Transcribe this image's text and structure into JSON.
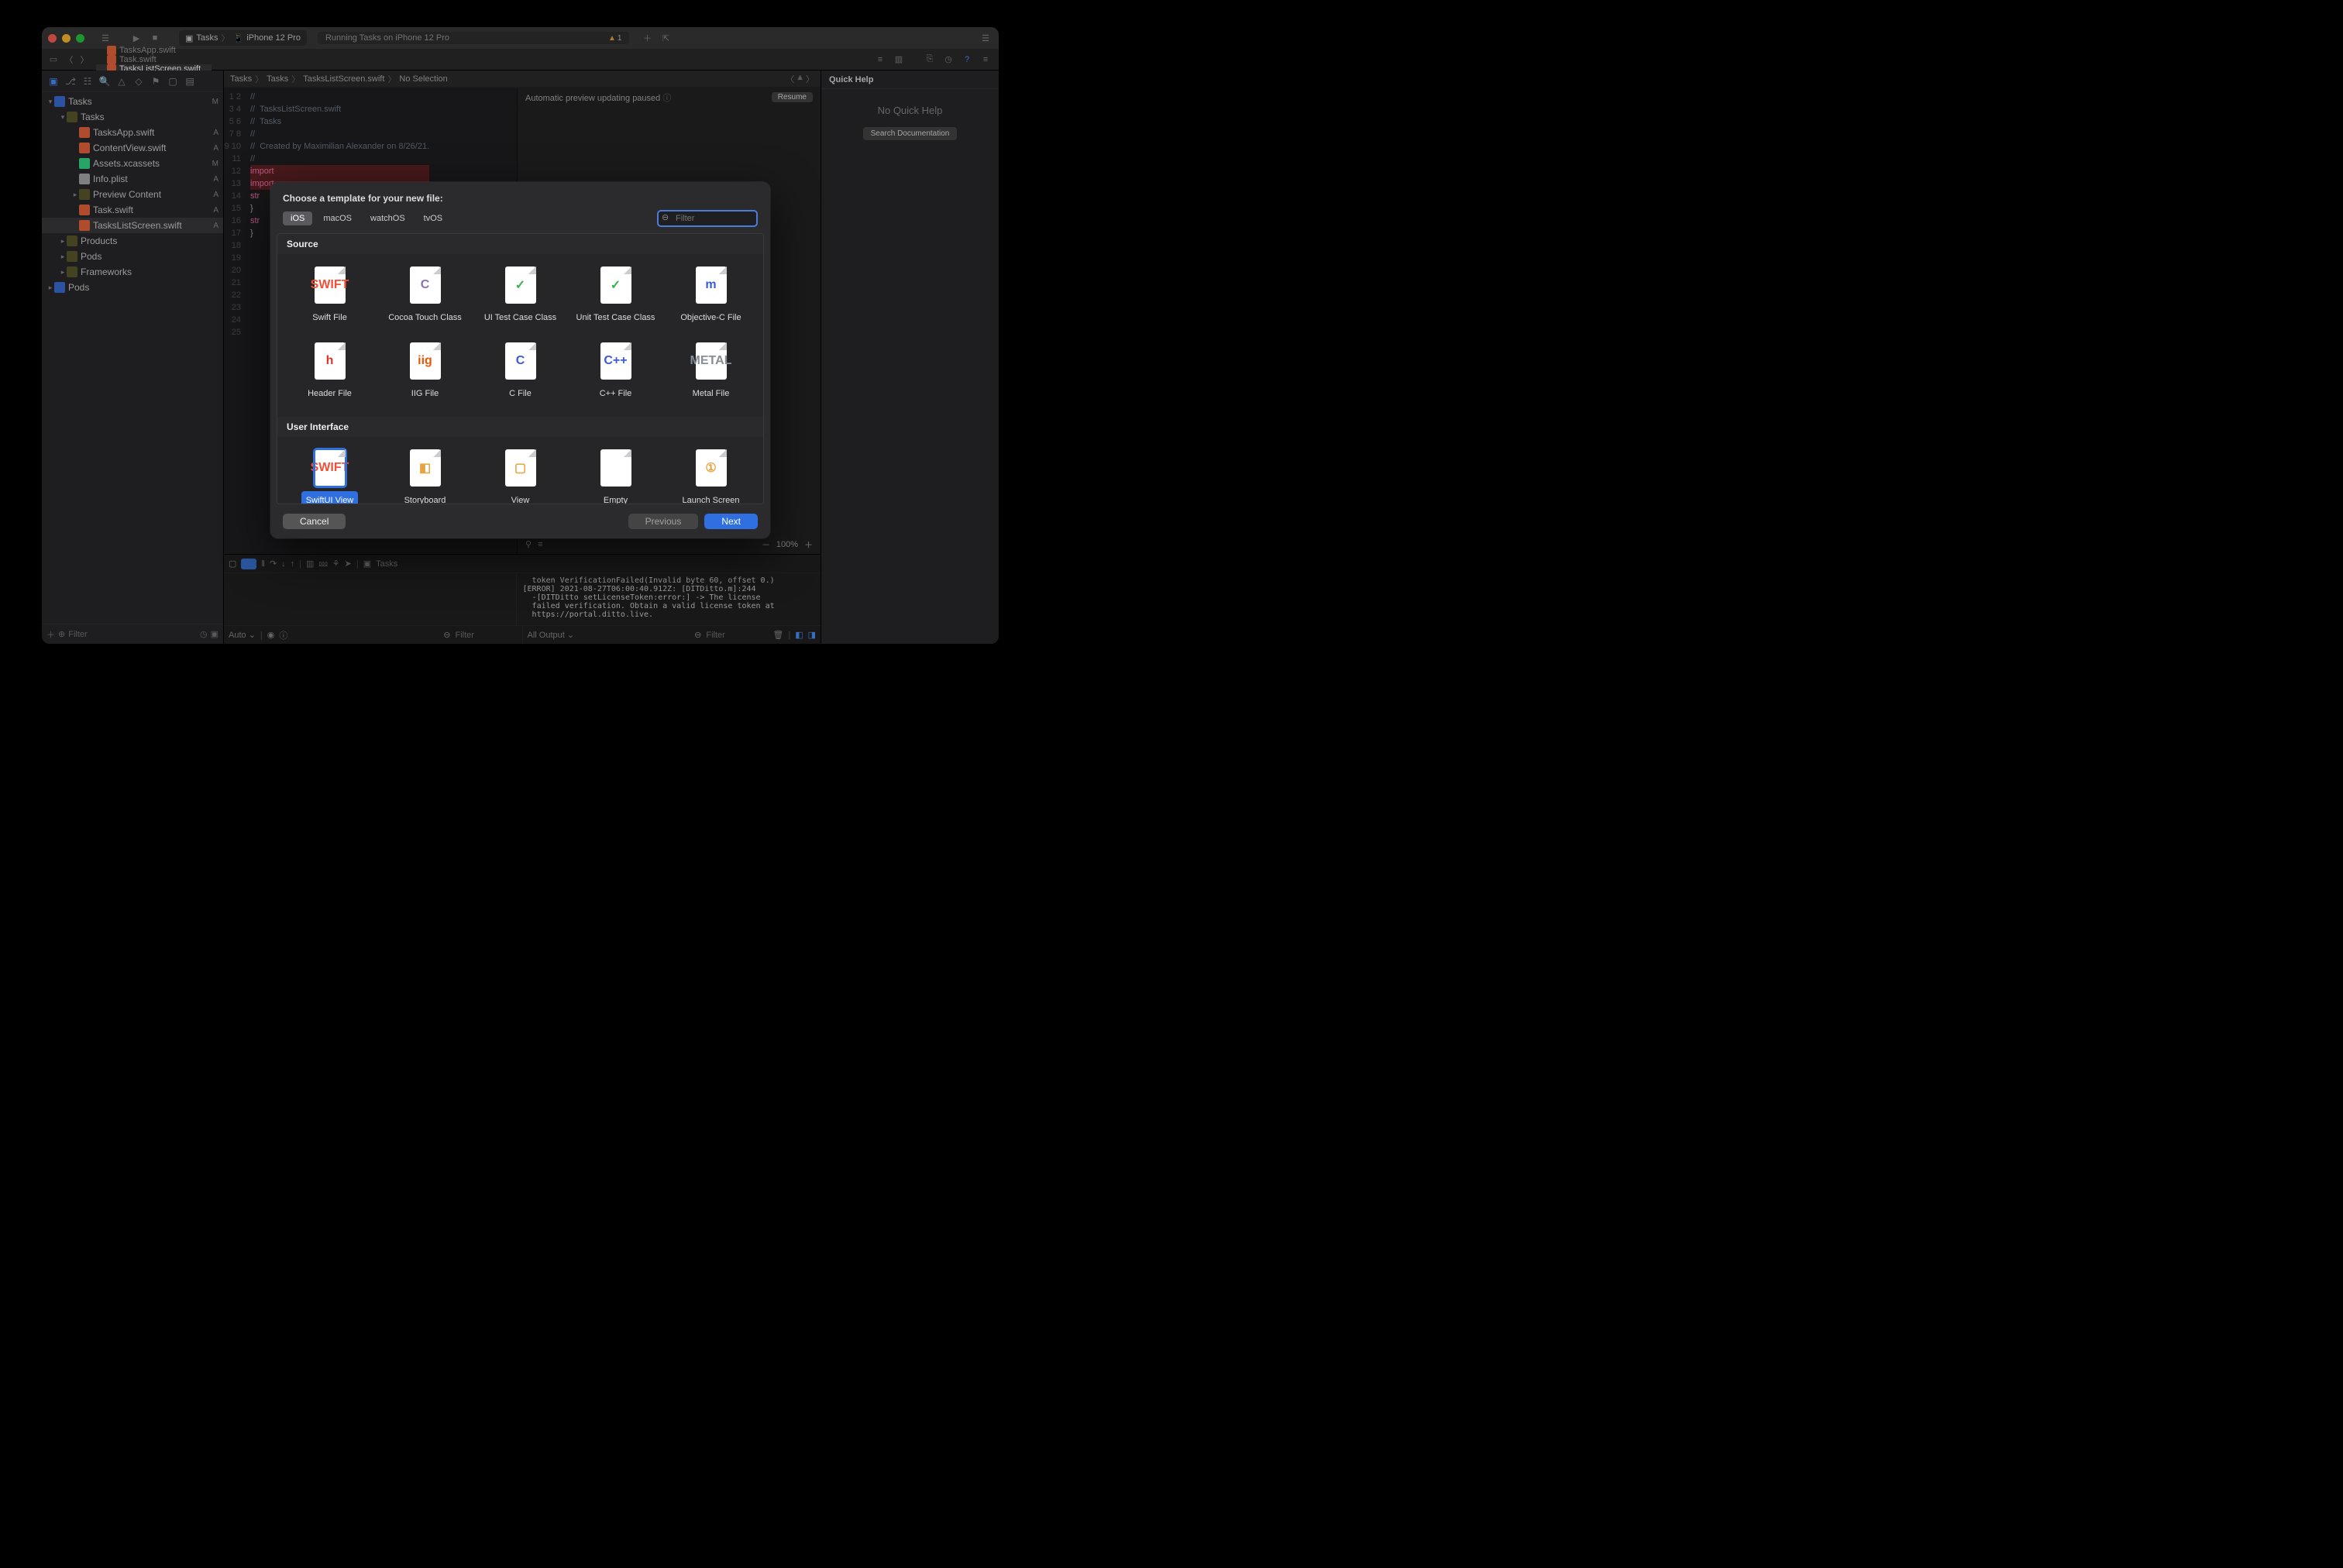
{
  "toolbar": {
    "scheme_app": "Tasks",
    "scheme_device": "iPhone 12 Pro",
    "status": "Running Tasks on iPhone 12 Pro",
    "warn_count": "1"
  },
  "tabs": [
    {
      "label": "TasksApp.swift",
      "active": false
    },
    {
      "label": "Task.swift",
      "active": false
    },
    {
      "label": "TasksListScreen.swift",
      "active": true
    }
  ],
  "jumpbar": [
    "Tasks",
    "Tasks",
    "TasksListScreen.swift",
    "No Selection"
  ],
  "navigator": {
    "filter_placeholder": "Filter",
    "tree": [
      {
        "depth": 0,
        "icon": "proj",
        "label": "Tasks",
        "stat": "M",
        "open": true
      },
      {
        "depth": 1,
        "icon": "fold",
        "label": "Tasks",
        "open": true
      },
      {
        "depth": 2,
        "icon": "swift",
        "label": "TasksApp.swift",
        "stat": "A"
      },
      {
        "depth": 2,
        "icon": "swift",
        "label": "ContentView.swift",
        "stat": "A"
      },
      {
        "depth": 2,
        "icon": "assets",
        "label": "Assets.xcassets",
        "stat": "M"
      },
      {
        "depth": 2,
        "icon": "plist",
        "label": "Info.plist",
        "stat": "A"
      },
      {
        "depth": 2,
        "icon": "fold",
        "label": "Preview Content",
        "stat": "A",
        "closed": true
      },
      {
        "depth": 2,
        "icon": "swift",
        "label": "Task.swift",
        "stat": "A"
      },
      {
        "depth": 2,
        "icon": "swift",
        "label": "TasksListScreen.swift",
        "stat": "A",
        "sel": true
      },
      {
        "depth": 1,
        "icon": "fold",
        "label": "Products",
        "closed": true
      },
      {
        "depth": 1,
        "icon": "fold",
        "label": "Pods",
        "closed": true
      },
      {
        "depth": 1,
        "icon": "fold",
        "label": "Frameworks",
        "closed": true
      },
      {
        "depth": 0,
        "icon": "proj",
        "label": "Pods",
        "closed": true
      }
    ]
  },
  "code": {
    "lines": [
      "//",
      "//  TasksListScreen.swift",
      "//  Tasks",
      "//",
      "//  Created by Maximilian Alexander on 8/26/21.",
      "//",
      "",
      "import",
      "import",
      "",
      "str",
      "",
      "",
      "",
      "",
      "",
      "",
      "}",
      "",
      "str",
      "",
      "",
      "",
      "}",
      ""
    ]
  },
  "preview": {
    "paused_text": "Automatic preview updating paused",
    "resume_label": "Resume",
    "zoom": "100%"
  },
  "inspector": {
    "title": "Quick Help",
    "no_quick_help": "No Quick Help",
    "search_label": "Search Documentation"
  },
  "debug": {
    "target": "Tasks",
    "auto_label": "Auto",
    "all_output_label": "All Output",
    "filter_placeholder": "Filter",
    "console": "  token VerificationFailed(Invalid byte 60, offset 0.)\n[ERROR] 2021-08-27T06:00:40.912Z: [DITDitto.m]:244\n  -[DITDitto setLicenseToken:error:] -> The license\n  failed verification. Obtain a valid license token at\n  https://portal.ditto.live."
  },
  "modal": {
    "title": "Choose a template for your new file:",
    "platform_tabs": [
      "iOS",
      "macOS",
      "watchOS",
      "tvOS"
    ],
    "platform_active": "iOS",
    "filter_placeholder": "Filter",
    "sections": [
      {
        "name": "Source",
        "items": [
          {
            "label": "Swift File",
            "mark": "SWIFT",
            "color": "#f05138"
          },
          {
            "label": "Cocoa Touch Class",
            "mark": "C",
            "color": "#8a6fb5"
          },
          {
            "label": "UI Test Case Class",
            "mark": "✓",
            "color": "#37b24d"
          },
          {
            "label": "Unit Test Case Class",
            "mark": "✓",
            "color": "#37b24d"
          },
          {
            "label": "Objective-C File",
            "mark": "m",
            "color": "#3b5bdb"
          },
          {
            "label": "Header File",
            "mark": "h",
            "color": "#e03131"
          },
          {
            "label": "IIG File",
            "mark": "iig",
            "color": "#e8590c"
          },
          {
            "label": "C File",
            "mark": "C",
            "color": "#3b5bdb"
          },
          {
            "label": "C++ File",
            "mark": "C++",
            "color": "#3b5bdb"
          },
          {
            "label": "Metal File",
            "mark": "METAL",
            "color": "#868e96"
          }
        ]
      },
      {
        "name": "User Interface",
        "items": [
          {
            "label": "SwiftUI View",
            "mark": "SWIFT",
            "color": "#f05138",
            "selected": true
          },
          {
            "label": "Storyboard",
            "mark": "◧",
            "color": "#e8a33d"
          },
          {
            "label": "View",
            "mark": "▢",
            "color": "#e8a33d"
          },
          {
            "label": "Empty",
            "mark": "",
            "color": "#adb5bd"
          },
          {
            "label": "Launch Screen",
            "mark": "①",
            "color": "#e8a33d"
          }
        ]
      }
    ],
    "cancel_label": "Cancel",
    "previous_label": "Previous",
    "next_label": "Next"
  }
}
